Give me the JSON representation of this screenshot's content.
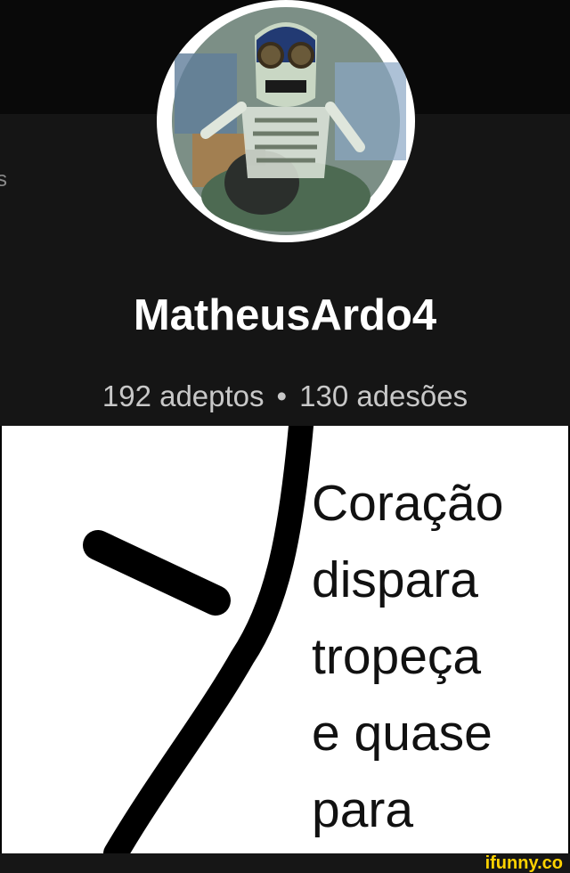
{
  "profile": {
    "username": "MatheusArdo4",
    "followers": "192 adeptos",
    "separator": "•",
    "subscriptions": "130 adesões",
    "edge_glyph": "s"
  },
  "meme": {
    "caption_lines": [
      "Coração",
      "dispara",
      "tropeça",
      "e quase",
      "para"
    ]
  },
  "footer": {
    "watermark": "ifunny.co"
  },
  "colors": {
    "profile_bg": "#151515",
    "username": "#ffffff",
    "stats": "#c8c8c8",
    "meme_bg": "#ffffff",
    "watermark": "#ffd200"
  },
  "icons": [
    "avatar-image",
    "ifunny-logo"
  ]
}
